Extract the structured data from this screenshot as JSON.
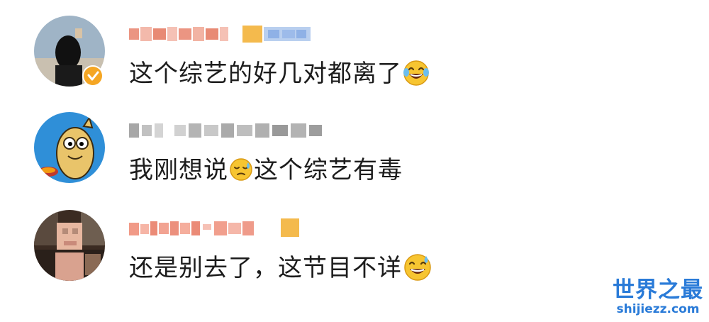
{
  "comments": [
    {
      "avatar_icon": "avatar-person-photo-icon",
      "verified": true,
      "username_blurred": true,
      "text_before": "这个综艺的好几对都离了",
      "emoji": "laughing-with-tears-emoji",
      "text_after": ""
    },
    {
      "avatar_icon": "avatar-cartoon-character-icon",
      "verified": false,
      "username_blurred": true,
      "text_before": "我刚想说",
      "emoji": "sweat-face-emoji",
      "text_after": "这个综艺有毒"
    },
    {
      "avatar_icon": "avatar-person-photo-icon",
      "verified": false,
      "username_blurred": true,
      "text_before": "还是别去了，这节目不详",
      "emoji": "grinning-sweat-emoji",
      "text_after": ""
    }
  ],
  "watermark": {
    "title": "世界之最",
    "url": "shijiezz.com"
  },
  "colors": {
    "accent": "#2a7bd8",
    "username_blur": "#e8826a",
    "verified": "#f5a623",
    "text": "#1c1c1c"
  }
}
